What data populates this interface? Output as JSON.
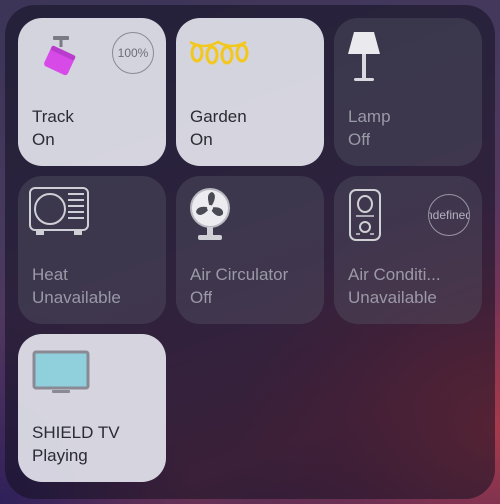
{
  "tiles": [
    {
      "name": "Track",
      "state": "On",
      "badge": "100%",
      "icon": "spotlight-icon"
    },
    {
      "name": "Garden",
      "state": "On",
      "icon": "string-lights-icon"
    },
    {
      "name": "Lamp",
      "state": "Off",
      "icon": "floor-lamp-icon"
    },
    {
      "name": "Heat",
      "state": "Unavailable",
      "icon": "heater-icon"
    },
    {
      "name": "Air Circulator",
      "state": "Off",
      "icon": "fan-icon"
    },
    {
      "name": "Air Conditi...",
      "state": "Unavailable",
      "badge": "ndefined",
      "icon": "air-purifier-icon"
    },
    {
      "name": "SHIELD TV",
      "state": "Playing",
      "icon": "tv-icon"
    }
  ],
  "colors": {
    "track_light": "#d84ae8",
    "garden_lights": "#f2c81e",
    "tv_screen": "#8fd0dc"
  }
}
